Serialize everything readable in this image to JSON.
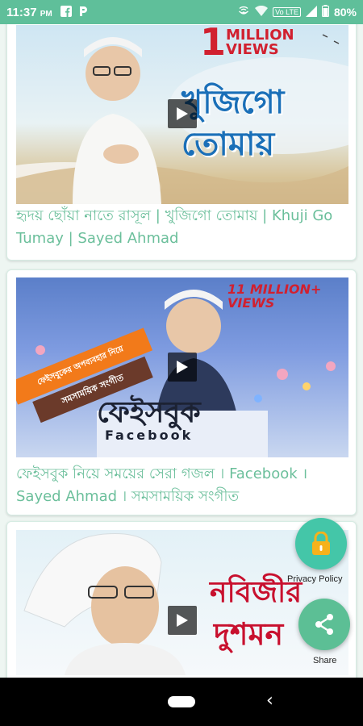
{
  "status_bar": {
    "time": "11:37",
    "ampm": "PM",
    "battery": "80%",
    "network_tag": "Vo LTE"
  },
  "videos": [
    {
      "title": "হৃদয় ছোঁয়া নাতে রাসূল | খুজিগো তোমায় | Khuji Go Tumay | Sayed Ahmad",
      "overlay_big": "1",
      "overlay_views": "MILLION VIEWS",
      "overlay_title": "খুজিগো তোমায়"
    },
    {
      "title": "ফেইসবুক নিয়ে সময়ের সেরা গজল । Facebook । Sayed Ahmad । সমসাময়িক সংগীত",
      "overlay_views": "11 MILLION+ VIEWS",
      "overlay_title": "ফেইসবুক",
      "overlay_sub": "Facebook",
      "banner_1": "ফেইসবুকের অপব্যবহার নিয়ে",
      "banner_2": "সমসাময়িক সংগীত"
    },
    {
      "overlay_title_1": "নবিজীর",
      "overlay_title_2": "দুশমন"
    }
  ],
  "fabs": {
    "privacy_label": "Privacy Policy",
    "share_label": "Share"
  },
  "colors": {
    "accent": "#5fbf9a",
    "caption": "#6bbf9b",
    "fab_privacy": "#44c6a8",
    "fab_share": "#5cbf95"
  },
  "icons": [
    "facebook-icon",
    "parking-icon",
    "hotspot-icon",
    "wifi-icon",
    "signal-icon",
    "battery-icon",
    "lock-icon",
    "share-icon",
    "play-icon"
  ]
}
